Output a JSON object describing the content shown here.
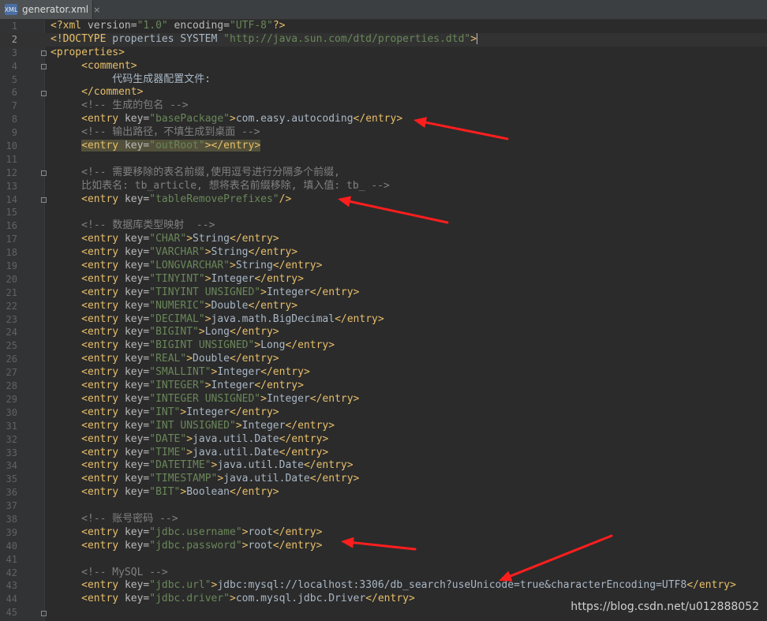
{
  "tab": {
    "icon_text": "XML",
    "label": "generator.xml",
    "close": "×"
  },
  "lines": [
    [
      "1",
      [
        [
          "tag",
          "<?xml "
        ],
        [
          "attr",
          "version="
        ],
        [
          "val",
          "\"1.0\""
        ],
        [
          "attr",
          " encoding="
        ],
        [
          "val",
          "\"UTF-8\""
        ],
        [
          "tag",
          "?>"
        ]
      ]
    ],
    [
      "2",
      [
        [
          "tag",
          "<!DOCTYPE "
        ],
        [
          "text",
          "properties SYSTEM "
        ],
        [
          "val",
          "\"http://java.sun.com/dtd/properties.dtd\""
        ],
        [
          "tag",
          ">"
        ]
      ]
    ],
    [
      "3",
      [
        [
          "tag",
          "<properties>"
        ]
      ]
    ],
    [
      "4",
      [
        [
          "text",
          "     "
        ],
        [
          "tag",
          "<comment>"
        ]
      ]
    ],
    [
      "5",
      [
        [
          "text",
          "          代码生成器配置文件:"
        ]
      ]
    ],
    [
      "6",
      [
        [
          "text",
          "     "
        ],
        [
          "tag",
          "</comment>"
        ]
      ]
    ],
    [
      "7",
      [
        [
          "text",
          "     "
        ],
        [
          "cmt",
          "<!-- 生成的包名 -->"
        ]
      ]
    ],
    [
      "8",
      [
        [
          "text",
          "     "
        ],
        [
          "tag",
          "<entry "
        ],
        [
          "attr",
          "key="
        ],
        [
          "val",
          "\"basePackage\""
        ],
        [
          "tag",
          ">"
        ],
        [
          "text",
          "com.easy.autocoding"
        ],
        [
          "tag",
          "</entry>"
        ]
      ]
    ],
    [
      "9",
      [
        [
          "text",
          "     "
        ],
        [
          "cmt",
          "<!-- 输出路径，不填生成到桌面 -->"
        ]
      ]
    ],
    [
      "10",
      [
        [
          "text",
          "     "
        ],
        [
          "tag",
          "<entry "
        ],
        [
          "attr",
          "key="
        ],
        [
          "val",
          "\"outRoot\""
        ],
        [
          "tag",
          "></entry>"
        ]
      ]
    ],
    [
      "11",
      []
    ],
    [
      "12",
      [
        [
          "text",
          "     "
        ],
        [
          "cmt",
          "<!-- 需要移除的表名前缀,使用逗号进行分隔多个前缀,"
        ]
      ]
    ],
    [
      "13",
      [
        [
          "cmt",
          "     比如表名: tb_article, 想将表名前缀移除, 填入值: tb_ -->"
        ]
      ]
    ],
    [
      "14",
      [
        [
          "text",
          "     "
        ],
        [
          "tag",
          "<entry "
        ],
        [
          "attr",
          "key="
        ],
        [
          "val",
          "\"tableRemovePrefixes\""
        ],
        [
          "tag",
          "/>"
        ]
      ]
    ],
    [
      "15",
      []
    ],
    [
      "16",
      [
        [
          "text",
          "     "
        ],
        [
          "cmt",
          "<!-- 数据库类型映射  -->"
        ]
      ]
    ],
    [
      "17",
      [
        [
          "text",
          "     "
        ],
        [
          "tag",
          "<entry "
        ],
        [
          "attr",
          "key="
        ],
        [
          "val",
          "\"CHAR\""
        ],
        [
          "tag",
          ">"
        ],
        [
          "text",
          "String"
        ],
        [
          "tag",
          "</entry>"
        ]
      ]
    ],
    [
      "18",
      [
        [
          "text",
          "     "
        ],
        [
          "tag",
          "<entry "
        ],
        [
          "attr",
          "key="
        ],
        [
          "val",
          "\"VARCHAR\""
        ],
        [
          "tag",
          ">"
        ],
        [
          "text",
          "String"
        ],
        [
          "tag",
          "</entry>"
        ]
      ]
    ],
    [
      "19",
      [
        [
          "text",
          "     "
        ],
        [
          "tag",
          "<entry "
        ],
        [
          "attr",
          "key="
        ],
        [
          "val",
          "\"LONGVARCHAR\""
        ],
        [
          "tag",
          ">"
        ],
        [
          "text",
          "String"
        ],
        [
          "tag",
          "</entry>"
        ]
      ]
    ],
    [
      "20",
      [
        [
          "text",
          "     "
        ],
        [
          "tag",
          "<entry "
        ],
        [
          "attr",
          "key="
        ],
        [
          "val",
          "\"TINYINT\""
        ],
        [
          "tag",
          ">"
        ],
        [
          "text",
          "Integer"
        ],
        [
          "tag",
          "</entry>"
        ]
      ]
    ],
    [
      "21",
      [
        [
          "text",
          "     "
        ],
        [
          "tag",
          "<entry "
        ],
        [
          "attr",
          "key="
        ],
        [
          "val",
          "\"TINYINT UNSIGNED\""
        ],
        [
          "tag",
          ">"
        ],
        [
          "text",
          "Integer"
        ],
        [
          "tag",
          "</entry>"
        ]
      ]
    ],
    [
      "22",
      [
        [
          "text",
          "     "
        ],
        [
          "tag",
          "<entry "
        ],
        [
          "attr",
          "key="
        ],
        [
          "val",
          "\"NUMERIC\""
        ],
        [
          "tag",
          ">"
        ],
        [
          "text",
          "Double"
        ],
        [
          "tag",
          "</entry>"
        ]
      ]
    ],
    [
      "23",
      [
        [
          "text",
          "     "
        ],
        [
          "tag",
          "<entry "
        ],
        [
          "attr",
          "key="
        ],
        [
          "val",
          "\"DECIMAL\""
        ],
        [
          "tag",
          ">"
        ],
        [
          "text",
          "java.math.BigDecimal"
        ],
        [
          "tag",
          "</entry>"
        ]
      ]
    ],
    [
      "24",
      [
        [
          "text",
          "     "
        ],
        [
          "tag",
          "<entry "
        ],
        [
          "attr",
          "key="
        ],
        [
          "val",
          "\"BIGINT\""
        ],
        [
          "tag",
          ">"
        ],
        [
          "text",
          "Long"
        ],
        [
          "tag",
          "</entry>"
        ]
      ]
    ],
    [
      "25",
      [
        [
          "text",
          "     "
        ],
        [
          "tag",
          "<entry "
        ],
        [
          "attr",
          "key="
        ],
        [
          "val",
          "\"BIGINT UNSIGNED\""
        ],
        [
          "tag",
          ">"
        ],
        [
          "text",
          "Long"
        ],
        [
          "tag",
          "</entry>"
        ]
      ]
    ],
    [
      "26",
      [
        [
          "text",
          "     "
        ],
        [
          "tag",
          "<entry "
        ],
        [
          "attr",
          "key="
        ],
        [
          "val",
          "\"REAL\""
        ],
        [
          "tag",
          ">"
        ],
        [
          "text",
          "Double"
        ],
        [
          "tag",
          "</entry>"
        ]
      ]
    ],
    [
      "27",
      [
        [
          "text",
          "     "
        ],
        [
          "tag",
          "<entry "
        ],
        [
          "attr",
          "key="
        ],
        [
          "val",
          "\"SMALLINT\""
        ],
        [
          "tag",
          ">"
        ],
        [
          "text",
          "Integer"
        ],
        [
          "tag",
          "</entry>"
        ]
      ]
    ],
    [
      "28",
      [
        [
          "text",
          "     "
        ],
        [
          "tag",
          "<entry "
        ],
        [
          "attr",
          "key="
        ],
        [
          "val",
          "\"INTEGER\""
        ],
        [
          "tag",
          ">"
        ],
        [
          "text",
          "Integer"
        ],
        [
          "tag",
          "</entry>"
        ]
      ]
    ],
    [
      "29",
      [
        [
          "text",
          "     "
        ],
        [
          "tag",
          "<entry "
        ],
        [
          "attr",
          "key="
        ],
        [
          "val",
          "\"INTEGER UNSIGNED\""
        ],
        [
          "tag",
          ">"
        ],
        [
          "text",
          "Integer"
        ],
        [
          "tag",
          "</entry>"
        ]
      ]
    ],
    [
      "30",
      [
        [
          "text",
          "     "
        ],
        [
          "tag",
          "<entry "
        ],
        [
          "attr",
          "key="
        ],
        [
          "val",
          "\"INT\""
        ],
        [
          "tag",
          ">"
        ],
        [
          "text",
          "Integer"
        ],
        [
          "tag",
          "</entry>"
        ]
      ]
    ],
    [
      "31",
      [
        [
          "text",
          "     "
        ],
        [
          "tag",
          "<entry "
        ],
        [
          "attr",
          "key="
        ],
        [
          "val",
          "\"INT UNSIGNED\""
        ],
        [
          "tag",
          ">"
        ],
        [
          "text",
          "Integer"
        ],
        [
          "tag",
          "</entry>"
        ]
      ]
    ],
    [
      "32",
      [
        [
          "text",
          "     "
        ],
        [
          "tag",
          "<entry "
        ],
        [
          "attr",
          "key="
        ],
        [
          "val",
          "\"DATE\""
        ],
        [
          "tag",
          ">"
        ],
        [
          "text",
          "java.util.Date"
        ],
        [
          "tag",
          "</entry>"
        ]
      ]
    ],
    [
      "33",
      [
        [
          "text",
          "     "
        ],
        [
          "tag",
          "<entry "
        ],
        [
          "attr",
          "key="
        ],
        [
          "val",
          "\"TIME\""
        ],
        [
          "tag",
          ">"
        ],
        [
          "text",
          "java.util.Date"
        ],
        [
          "tag",
          "</entry>"
        ]
      ]
    ],
    [
      "34",
      [
        [
          "text",
          "     "
        ],
        [
          "tag",
          "<entry "
        ],
        [
          "attr",
          "key="
        ],
        [
          "val",
          "\"DATETIME\""
        ],
        [
          "tag",
          ">"
        ],
        [
          "text",
          "java.util.Date"
        ],
        [
          "tag",
          "</entry>"
        ]
      ]
    ],
    [
      "35",
      [
        [
          "text",
          "     "
        ],
        [
          "tag",
          "<entry "
        ],
        [
          "attr",
          "key="
        ],
        [
          "val",
          "\"TIMESTAMP\""
        ],
        [
          "tag",
          ">"
        ],
        [
          "text",
          "java.util.Date"
        ],
        [
          "tag",
          "</entry>"
        ]
      ]
    ],
    [
      "36",
      [
        [
          "text",
          "     "
        ],
        [
          "tag",
          "<entry "
        ],
        [
          "attr",
          "key="
        ],
        [
          "val",
          "\"BIT\""
        ],
        [
          "tag",
          ">"
        ],
        [
          "text",
          "Boolean"
        ],
        [
          "tag",
          "</entry>"
        ]
      ]
    ],
    [
      "37",
      []
    ],
    [
      "38",
      [
        [
          "text",
          "     "
        ],
        [
          "cmt",
          "<!-- 账号密码 -->"
        ]
      ]
    ],
    [
      "39",
      [
        [
          "text",
          "     "
        ],
        [
          "tag",
          "<entry "
        ],
        [
          "attr",
          "key="
        ],
        [
          "val",
          "\"jdbc.username\""
        ],
        [
          "tag",
          ">"
        ],
        [
          "text",
          "root"
        ],
        [
          "tag",
          "</entry>"
        ]
      ]
    ],
    [
      "40",
      [
        [
          "text",
          "     "
        ],
        [
          "tag",
          "<entry "
        ],
        [
          "attr",
          "key="
        ],
        [
          "val",
          "\"jdbc.password\""
        ],
        [
          "tag",
          ">"
        ],
        [
          "text",
          "root"
        ],
        [
          "tag",
          "</entry>"
        ]
      ]
    ],
    [
      "41",
      []
    ],
    [
      "42",
      [
        [
          "text",
          "     "
        ],
        [
          "cmt",
          "<!-- MySQL -->"
        ]
      ]
    ],
    [
      "43",
      [
        [
          "text",
          "     "
        ],
        [
          "tag",
          "<entry "
        ],
        [
          "attr",
          "key="
        ],
        [
          "val",
          "\"jdbc.url\""
        ],
        [
          "tag",
          ">"
        ],
        [
          "text",
          "jdbc:mysql://localhost:3306/db_search?useUnicode=true&characterEncoding=UTF8"
        ],
        [
          "tag",
          "</entry>"
        ]
      ]
    ],
    [
      "44",
      [
        [
          "text",
          "     "
        ],
        [
          "tag",
          "<entry "
        ],
        [
          "attr",
          "key="
        ],
        [
          "val",
          "\"jdbc.driver\""
        ],
        [
          "tag",
          ">"
        ],
        [
          "text",
          "com.mysql.jdbc.Driver"
        ],
        [
          "tag",
          "</entry>"
        ]
      ]
    ],
    [
      "45",
      []
    ]
  ],
  "current_line": "2",
  "highlighted_line": "10",
  "watermark": "https://blog.csdn.net/u012888052",
  "colors": {
    "arrow": "#ff1e1e",
    "tag": "#e8bf6a",
    "value": "#6a8759",
    "comment": "#808080"
  }
}
